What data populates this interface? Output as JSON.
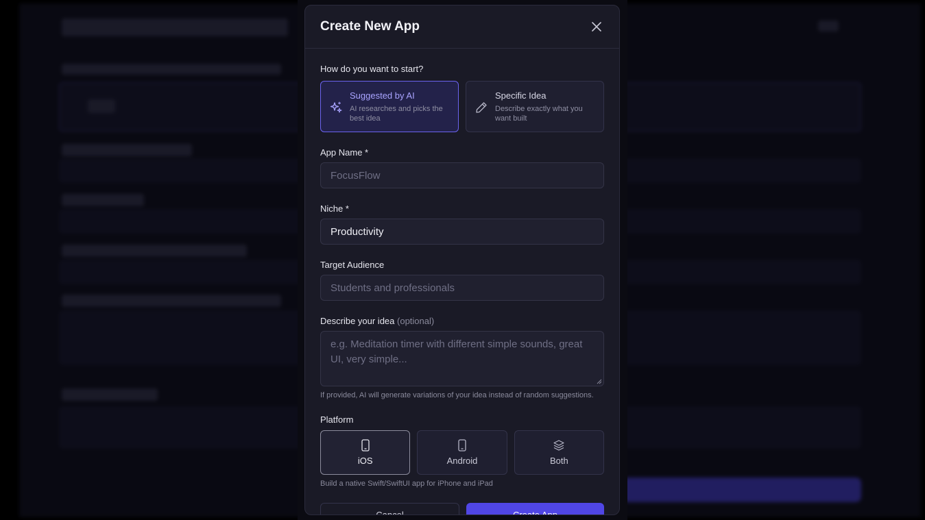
{
  "modal": {
    "title": "Create New App",
    "start_question": "How do you want to start?",
    "start_options": [
      {
        "title": "Suggested by AI",
        "description": "AI researches and picks the best idea",
        "icon": "sparkles-icon",
        "selected": true
      },
      {
        "title": "Specific Idea",
        "description": "Describe exactly what you want built",
        "icon": "pencil-icon",
        "selected": false
      }
    ],
    "app_name": {
      "label": "App Name *",
      "placeholder": "FocusFlow",
      "value": ""
    },
    "niche": {
      "label": "Niche *",
      "value": "Productivity"
    },
    "target_audience": {
      "label": "Target Audience",
      "placeholder": "Students and professionals",
      "value": ""
    },
    "idea": {
      "label": "Describe your idea",
      "optional": "(optional)",
      "placeholder": "e.g. Meditation timer with different simple sounds, great UI, very simple...",
      "hint": "If provided, AI will generate variations of your idea instead of random suggestions."
    },
    "platform": {
      "label": "Platform",
      "options": [
        {
          "label": "iOS",
          "icon": "phone-icon",
          "selected": true
        },
        {
          "label": "Android",
          "icon": "phone-icon",
          "selected": false
        },
        {
          "label": "Both",
          "icon": "layers-icon",
          "selected": false
        }
      ],
      "hint": "Build a native Swift/SwiftUI app for iPhone and iPad"
    },
    "cancel_label": "Cancel",
    "create_label": "Create App"
  },
  "colors": {
    "accent": "#5046e5",
    "selected_border": "#6b63f0",
    "modal_bg": "#1a1a26"
  }
}
